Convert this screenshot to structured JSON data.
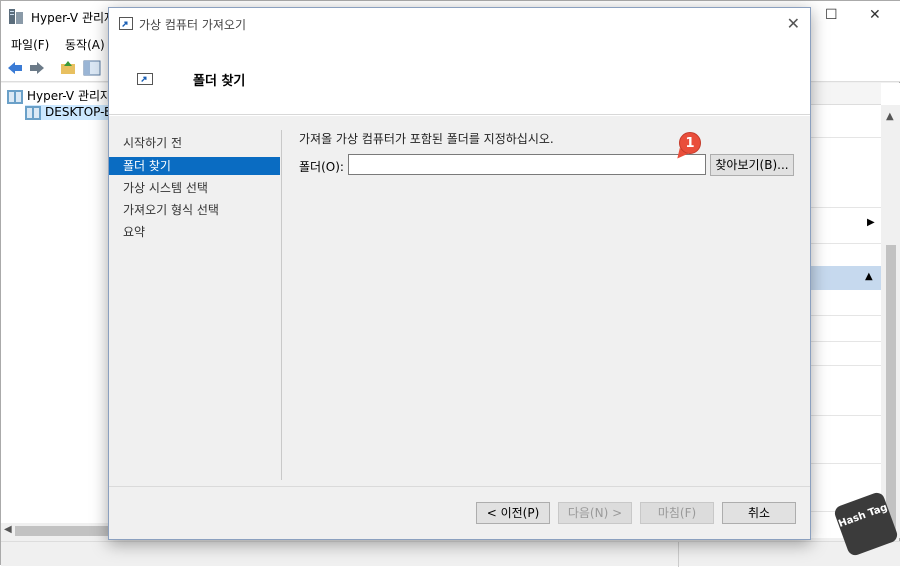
{
  "main_window": {
    "title": "Hyper-V 관리자",
    "controls": {
      "minimize": "—",
      "maximize": "☐",
      "close": "✕"
    },
    "menu": [
      {
        "label": "파일(F)"
      },
      {
        "label": "동작(A)"
      }
    ],
    "tree": [
      {
        "label": "Hyper-V 관리자"
      },
      {
        "label": "DESKTOP-B"
      }
    ]
  },
  "dialog": {
    "title": "가상 컴퓨터 가져오기",
    "close": "✕",
    "heading": "폴더 찾기",
    "nav_items": [
      {
        "label": "시작하기 전",
        "active": false
      },
      {
        "label": "폴더 찾기",
        "active": true
      },
      {
        "label": "가상 시스템 선택",
        "active": false
      },
      {
        "label": "가져오기 형식 선택",
        "active": false
      },
      {
        "label": "요약",
        "active": false
      }
    ],
    "instruction": "가져올 가상 컴퓨터가 포함된 폴더를 지정하십시오.",
    "folder": {
      "label": "폴더(O):",
      "value": ""
    },
    "browse_label": "찾아보기(B)...",
    "buttons": {
      "prev": "< 이전(P)",
      "next": "다음(N) >",
      "finish": "마침(F)",
      "cancel": "취소"
    }
  },
  "annotation": {
    "badge": "1"
  },
  "watermark": {
    "text": "Hash Tag"
  },
  "colors": {
    "accent": "#0a6cc2",
    "badge": "#e94e3b"
  }
}
